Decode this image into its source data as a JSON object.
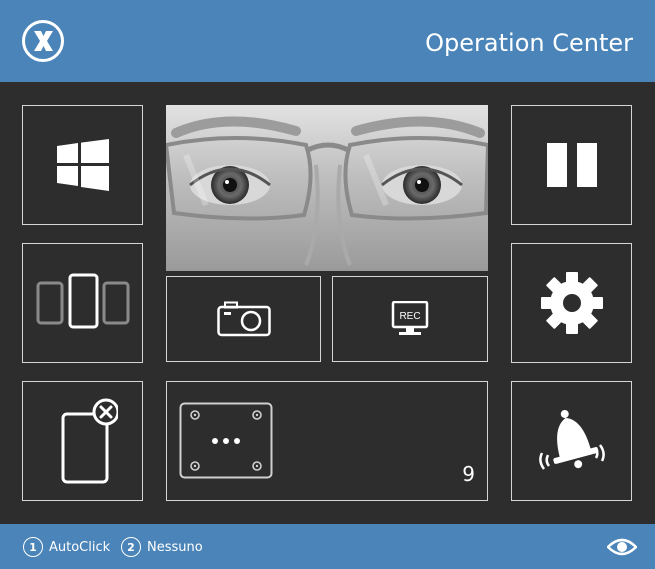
{
  "header": {
    "title": "Operation Center",
    "logo_icon": "close-circle-icon"
  },
  "tiles": {
    "windows": {
      "icon": "windows-icon"
    },
    "device_switch": {
      "icon": "devices-icon"
    },
    "close_device": {
      "icon": "device-close-icon"
    },
    "eye_feed": {
      "icon": "camera-feed"
    },
    "snapshot": {
      "icon": "camera-icon"
    },
    "record": {
      "icon": "screen-record-icon",
      "label": "REC"
    },
    "calibration": {
      "icon": "calibration-grid-icon",
      "count": "9"
    },
    "pause": {
      "icon": "pause-icon"
    },
    "settings": {
      "icon": "gear-icon"
    },
    "alarm": {
      "icon": "bell-icon"
    }
  },
  "footer": {
    "items": [
      {
        "num": "1",
        "label": "AutoClick"
      },
      {
        "num": "2",
        "label": "Nessuno"
      }
    ],
    "eye_icon": "eye-icon"
  },
  "colors": {
    "accent": "#4a84b8",
    "background": "#2d2d2d",
    "tile_border": "#d6d6d6"
  }
}
